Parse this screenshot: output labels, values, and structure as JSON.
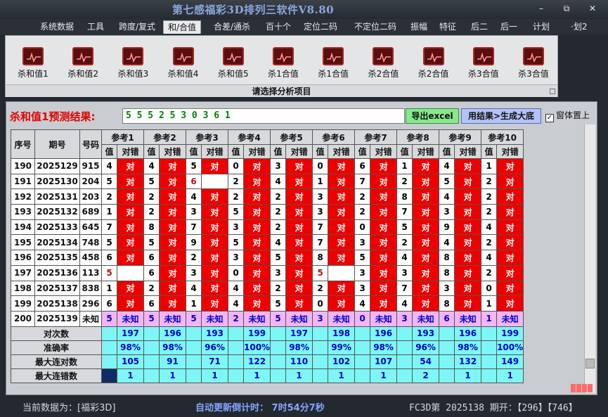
{
  "app": {
    "title": "第七感福彩3D排列三软件V8.80"
  },
  "window_buttons": {
    "minimize": "–",
    "restore": "⧉",
    "close": "✕"
  },
  "menu": [
    {
      "label": "系统数据",
      "active": false
    },
    {
      "label": "工具",
      "active": false
    },
    {
      "label": "跨度/复式",
      "active": false
    },
    {
      "label": "和/合值",
      "active": true
    },
    {
      "label": "合差/通杀",
      "active": false
    },
    {
      "label": "百十个",
      "active": false
    },
    {
      "label": "定位二码",
      "active": false
    },
    {
      "label": "不定位二码",
      "active": false
    },
    {
      "label": "振幅",
      "active": false
    },
    {
      "label": "特征",
      "active": false
    },
    {
      "label": "后二",
      "active": false
    },
    {
      "label": "后一",
      "active": false
    },
    {
      "label": "计划",
      "active": false
    },
    {
      "label": "·划2",
      "active": false
    }
  ],
  "ribbon": {
    "buttons": [
      "杀和值1",
      "杀和值2",
      "杀和值3",
      "杀和值4",
      "杀和值5",
      "杀1合值",
      "杀1合值",
      "杀2合值",
      "杀2合值",
      "杀3合值",
      "杀3合值"
    ],
    "caption": "请选择分析项目"
  },
  "prediction": {
    "label": "杀和值1预测结果:",
    "value": "5 5 5 2 5 3 0 3 6 1",
    "excel_button": "导出excel",
    "generate_button": "用结果>生成大底",
    "ontop_label": "窗体置上",
    "ontop_checked": "✓"
  },
  "table": {
    "headers": {
      "seq": "序号",
      "period": "期号",
      "number": "号码",
      "val": "值",
      "result": "对错"
    },
    "ref_headers": [
      "参考1",
      "参考2",
      "参考3",
      "参考4",
      "参考5",
      "参考6",
      "参考7",
      "参考8",
      "参考9",
      "参考10"
    ],
    "rows": [
      {
        "seq": "190",
        "period": "2025129",
        "number": "915",
        "cells": [
          [
            "4",
            "对"
          ],
          [
            "4",
            "对"
          ],
          [
            "5",
            "对"
          ],
          [
            "0",
            "对"
          ],
          [
            "3",
            "对"
          ],
          [
            "0",
            "对"
          ],
          [
            "6",
            "对"
          ],
          [
            "1",
            "对"
          ],
          [
            "4",
            "对"
          ],
          [
            "1",
            "对"
          ]
        ]
      },
      {
        "seq": "191",
        "period": "2025130",
        "number": "204",
        "cells": [
          [
            "5",
            "对"
          ],
          [
            "5",
            "对"
          ],
          [
            "6",
            ""
          ],
          [
            "2",
            "对"
          ],
          [
            "4",
            "对"
          ],
          [
            "1",
            "对"
          ],
          [
            "7",
            "对"
          ],
          [
            "2",
            "对"
          ],
          [
            "5",
            "对"
          ],
          [
            "2",
            "对"
          ]
        ]
      },
      {
        "seq": "192",
        "period": "2025131",
        "number": "203",
        "cells": [
          [
            "2",
            "对"
          ],
          [
            "2",
            "对"
          ],
          [
            "4",
            "对"
          ],
          [
            "2",
            "对"
          ],
          [
            "2",
            "对"
          ],
          [
            "3",
            "对"
          ],
          [
            "2",
            "对"
          ],
          [
            "8",
            "对"
          ],
          [
            "4",
            "对"
          ],
          [
            "2",
            "对"
          ]
        ]
      },
      {
        "seq": "193",
        "period": "2025132",
        "number": "689",
        "cells": [
          [
            "1",
            "对"
          ],
          [
            "2",
            "对"
          ],
          [
            "3",
            "对"
          ],
          [
            "5",
            "对"
          ],
          [
            "2",
            "对"
          ],
          [
            "3",
            "对"
          ],
          [
            "2",
            "对"
          ],
          [
            "7",
            "对"
          ],
          [
            "3",
            "对"
          ],
          [
            "2",
            "对"
          ]
        ]
      },
      {
        "seq": "194",
        "period": "2025133",
        "number": "645",
        "cells": [
          [
            "7",
            "对"
          ],
          [
            "8",
            "对"
          ],
          [
            "7",
            "对"
          ],
          [
            "3",
            "对"
          ],
          [
            "2",
            "对"
          ],
          [
            "7",
            "对"
          ],
          [
            "0",
            "对"
          ],
          [
            "5",
            "对"
          ],
          [
            "9",
            "对"
          ],
          [
            "4",
            "对"
          ]
        ]
      },
      {
        "seq": "195",
        "period": "2025134",
        "number": "748",
        "cells": [
          [
            "5",
            "对"
          ],
          [
            "5",
            "对"
          ],
          [
            "9",
            "对"
          ],
          [
            "5",
            "对"
          ],
          [
            "4",
            "对"
          ],
          [
            "7",
            "对"
          ],
          [
            "3",
            "对"
          ],
          [
            "2",
            "对"
          ],
          [
            "4",
            "对"
          ],
          [
            "2",
            "对"
          ]
        ]
      },
      {
        "seq": "196",
        "period": "2025135",
        "number": "458",
        "cells": [
          [
            "6",
            "对"
          ],
          [
            "6",
            "对"
          ],
          [
            "2",
            "对"
          ],
          [
            "3",
            "对"
          ],
          [
            "5",
            "对"
          ],
          [
            "8",
            "对"
          ],
          [
            "5",
            "对"
          ],
          [
            "4",
            "对"
          ],
          [
            "8",
            "对"
          ],
          [
            "4",
            "对"
          ]
        ]
      },
      {
        "seq": "197",
        "period": "2025136",
        "number": "113",
        "cells": [
          [
            "5",
            ""
          ],
          [
            "6",
            "对"
          ],
          [
            "3",
            "对"
          ],
          [
            "0",
            "对"
          ],
          [
            "3",
            "对"
          ],
          [
            "5",
            ""
          ],
          [
            "3",
            "对"
          ],
          [
            "3",
            "对"
          ],
          [
            "8",
            "对"
          ],
          [
            "2",
            "对"
          ]
        ]
      },
      {
        "seq": "198",
        "period": "2025137",
        "number": "838",
        "cells": [
          [
            "1",
            "对"
          ],
          [
            "2",
            "对"
          ],
          [
            "4",
            "对"
          ],
          [
            "4",
            "对"
          ],
          [
            "2",
            "对"
          ],
          [
            "2",
            "对"
          ],
          [
            "3",
            "对"
          ],
          [
            "7",
            "对"
          ],
          [
            "3",
            "对"
          ],
          [
            "0",
            "对"
          ]
        ]
      },
      {
        "seq": "199",
        "period": "2025138",
        "number": "296",
        "cells": [
          [
            "6",
            "对"
          ],
          [
            "6",
            "对"
          ],
          [
            "1",
            "对"
          ],
          [
            "4",
            "对"
          ],
          [
            "5",
            "对"
          ],
          [
            "0",
            "对"
          ],
          [
            "4",
            "对"
          ],
          [
            "4",
            "对"
          ],
          [
            "8",
            "对"
          ],
          [
            "1",
            "对"
          ]
        ]
      }
    ],
    "predict_row": {
      "seq": "200",
      "period": "2025139",
      "number": "未知",
      "cells": [
        [
          "5",
          "未知"
        ],
        [
          "5",
          "未知"
        ],
        [
          "5",
          "未知"
        ],
        [
          "2",
          "未知"
        ],
        [
          "5",
          "未知"
        ],
        [
          "3",
          "未知"
        ],
        [
          "0",
          "未知"
        ],
        [
          "3",
          "未知"
        ],
        [
          "6",
          "未知"
        ],
        [
          "1",
          "未知"
        ]
      ]
    },
    "stats": [
      {
        "label": "对次数",
        "values": [
          "197",
          "196",
          "193",
          "199",
          "197",
          "198",
          "196",
          "193",
          "196",
          "199"
        ]
      },
      {
        "label": "准确率",
        "values": [
          "98%",
          "98%",
          "96%",
          "100%",
          "98%",
          "99%",
          "98%",
          "96%",
          "98%",
          "100%"
        ]
      },
      {
        "label": "最大连对数",
        "values": [
          "105",
          "91",
          "71",
          "122",
          "110",
          "102",
          "107",
          "54",
          "132",
          "149"
        ]
      },
      {
        "label": "最大连错数",
        "values": [
          "1",
          "1",
          "1",
          "1",
          "1",
          "1",
          "1",
          "2",
          "1",
          "1"
        ]
      }
    ]
  },
  "status": {
    "current": "当前数据为：[福彩3D]",
    "countdown": "自动更新倒计时： 7时54分7秒",
    "right": "FC3D第 2025138 期开：【296】【746】"
  },
  "colors": {
    "correct": "#ee0000",
    "stats": "#7ef6f6",
    "predict": "#f3b5f3",
    "accent": "#8aa7e0"
  }
}
